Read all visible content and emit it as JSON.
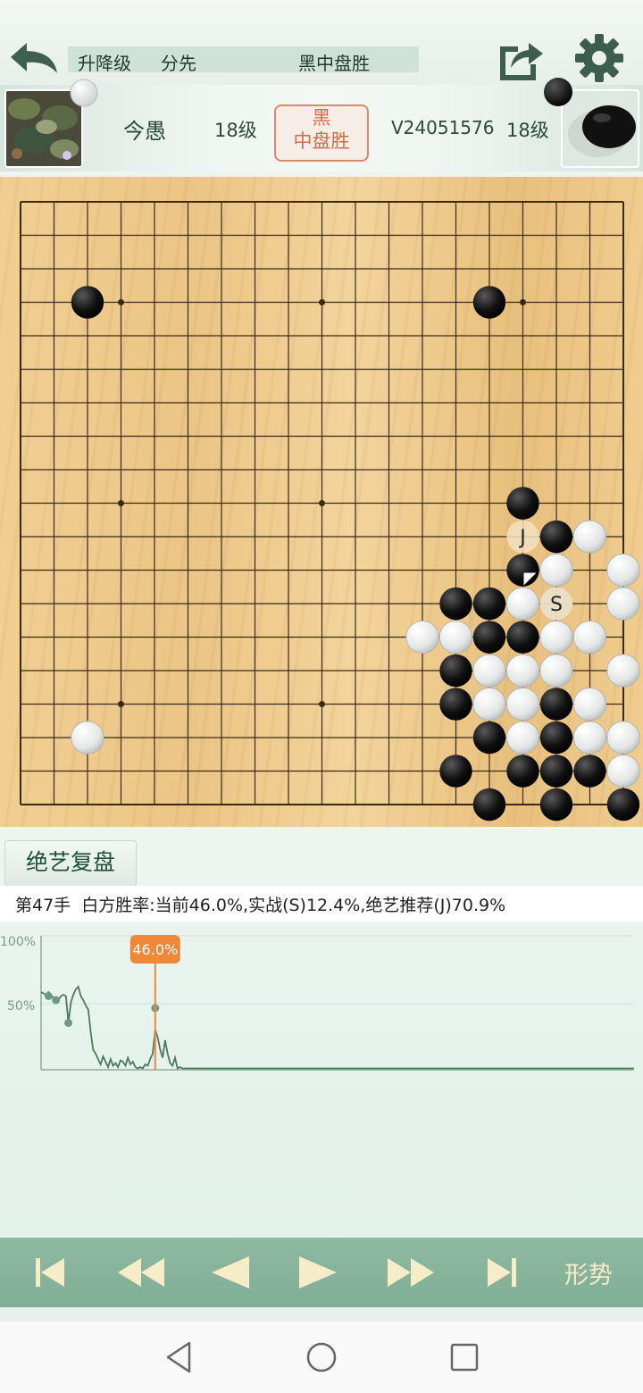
{
  "header": {
    "mode_label": "升降级",
    "handicap_label": "分先",
    "result_title": "黑中盘胜"
  },
  "players": {
    "white_name": "今愚",
    "white_rank": "18级",
    "black_name": "V24051576",
    "black_rank": "18级",
    "result_line1": "黑",
    "result_line2": "中盘胜"
  },
  "board": {
    "size": 19,
    "stars": [
      [
        3,
        3
      ],
      [
        3,
        9
      ],
      [
        3,
        15
      ],
      [
        9,
        3
      ],
      [
        9,
        9
      ],
      [
        9,
        15
      ],
      [
        15,
        3
      ],
      [
        15,
        9
      ],
      [
        15,
        15
      ]
    ],
    "black_stones": [
      [
        2,
        3
      ],
      [
        14,
        3
      ],
      [
        15,
        9
      ],
      [
        16,
        10
      ],
      [
        15,
        11
      ],
      [
        13,
        12
      ],
      [
        14,
        12
      ],
      [
        14,
        13
      ],
      [
        15,
        13
      ],
      [
        13,
        14
      ],
      [
        13,
        15
      ],
      [
        16,
        15
      ],
      [
        14,
        16
      ],
      [
        16,
        16
      ],
      [
        13,
        17
      ],
      [
        15,
        17
      ],
      [
        16,
        17
      ],
      [
        17,
        17
      ],
      [
        14,
        18
      ],
      [
        16,
        18
      ],
      [
        18,
        18
      ]
    ],
    "white_stones": [
      [
        17,
        10
      ],
      [
        16,
        11
      ],
      [
        18,
        11
      ],
      [
        15,
        12
      ],
      [
        18,
        12
      ],
      [
        12,
        13
      ],
      [
        13,
        13
      ],
      [
        16,
        13
      ],
      [
        17,
        13
      ],
      [
        14,
        14
      ],
      [
        15,
        14
      ],
      [
        16,
        14
      ],
      [
        18,
        14
      ],
      [
        14,
        15
      ],
      [
        15,
        15
      ],
      [
        17,
        15
      ],
      [
        15,
        16
      ],
      [
        17,
        16
      ],
      [
        18,
        16
      ],
      [
        2,
        16
      ],
      [
        18,
        17
      ]
    ],
    "last_move": [
      15,
      11
    ],
    "marker_J": "J",
    "marker_S": "S"
  },
  "analysis": {
    "tab_label": "绝艺复盘",
    "move_text": "第47手",
    "stats_text": "白方胜率:当前46.0%,实战(S)12.4%,绝艺推荐(J)70.9%"
  },
  "chart_data": {
    "type": "line",
    "title": "",
    "ytick_labels": [
      "100%",
      "50%"
    ],
    "ylim": [
      0,
      100
    ],
    "current_move": 47,
    "current_value_label": "46.0%",
    "x": [
      1,
      2,
      3,
      4,
      5,
      6,
      7,
      8,
      9,
      10,
      11,
      12,
      13,
      14,
      15,
      16,
      17,
      18,
      19,
      20,
      21,
      22,
      23,
      24,
      25,
      26,
      27,
      28,
      29,
      30,
      31,
      32,
      33,
      34,
      35,
      36,
      37,
      38,
      39,
      40,
      41,
      42,
      43,
      44,
      45,
      46,
      47,
      48,
      49,
      50,
      51,
      52,
      53,
      54,
      55,
      56,
      57,
      58,
      59,
      60,
      240
    ],
    "series": [
      {
        "values": [
          58,
          57,
          56,
          58,
          55,
          54,
          54,
          52,
          55,
          56,
          55,
          35,
          50,
          56,
          60,
          62,
          55,
          52,
          48,
          45,
          28,
          15,
          12,
          8,
          4,
          10,
          6,
          2,
          8,
          3,
          5,
          2,
          7,
          6,
          3,
          9,
          4,
          6,
          2,
          1,
          2,
          1,
          4,
          3,
          8,
          12,
          30,
          24,
          15,
          9,
          22,
          12,
          5,
          3,
          9,
          1,
          2,
          1,
          1,
          1,
          1
        ]
      }
    ]
  },
  "controls": {
    "form_label": "形势",
    "colors": {
      "bar": "#86b39a",
      "icon": "#f7ecc8"
    }
  },
  "navbar": {
    "icons": [
      "back-triangle-icon",
      "home-circle-icon",
      "recents-square-icon"
    ]
  }
}
